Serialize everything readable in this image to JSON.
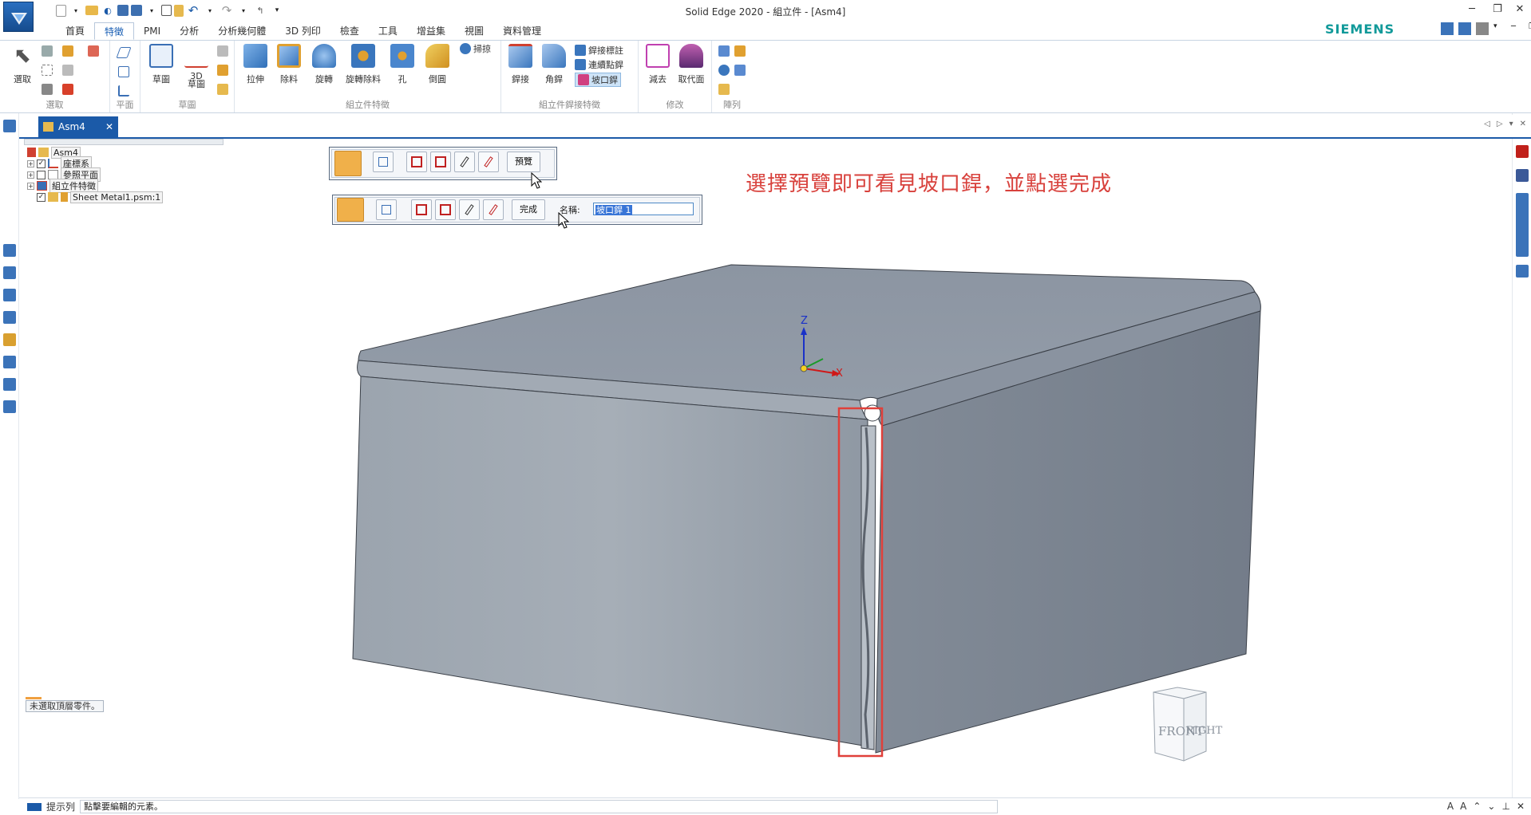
{
  "window": {
    "title": "Solid Edge 2020 - 組立件 - [Asm4]",
    "minimize": "─",
    "restore": "❐",
    "close": "✕"
  },
  "brand": "SIEMENS",
  "ribbon_tabs": [
    "首頁",
    "特徵",
    "PMI",
    "分析",
    "分析幾何體",
    "3D 列印",
    "檢查",
    "工具",
    "增益集",
    "視圖",
    "資料管理"
  ],
  "active_tab": "特徵",
  "ribbon": {
    "select_group": {
      "label": "選取",
      "select_btn": "選取"
    },
    "plane_group": {
      "label": "平面"
    },
    "sketch_group": {
      "label": "草圖",
      "sketch_btn": "草圖",
      "sketch3d_btn": "3D\n草圖"
    },
    "assembly_features": {
      "label": "組立件特徵",
      "buttons": [
        "拉伸",
        "除料",
        "旋轉",
        "旋轉除料",
        "孔",
        "倒圓"
      ],
      "sweep": "掃掠"
    },
    "weld_features": {
      "label": "組立件銲接特徵",
      "buttons": [
        "銲接",
        "角銲"
      ],
      "weld_label_btn": "銲接標註",
      "stitch_weld_btn": "連續點銲",
      "groove_weld_btn": "坡口銲"
    },
    "modify_group": {
      "label": "修改",
      "buttons": [
        "減去",
        "取代面"
      ]
    },
    "pattern_group": {
      "label": "陣列"
    }
  },
  "document_tab": {
    "name": "Asm4"
  },
  "pathfinder": {
    "tree": [
      {
        "label": "Asm4",
        "level": 0
      },
      {
        "label": "座標系",
        "level": 1,
        "checked": true
      },
      {
        "label": "參照平面",
        "level": 1,
        "checked": false
      },
      {
        "label": "組立件特徵",
        "level": 1
      },
      {
        "label": "Sheet Metal1.psm:1",
        "level": 1,
        "checked": true
      }
    ],
    "status": "未選取頂層零件。"
  },
  "commandbar_preview": {
    "preview_btn": "預覽"
  },
  "commandbar_finish": {
    "finish_btn": "完成",
    "name_label": "名稱:",
    "name_value": "坡口銲 1"
  },
  "annotation": "選擇預覽即可看見坡口銲，並點選完成",
  "triad": {
    "z": "Z",
    "x": "X"
  },
  "viewcube": {
    "front": "FRONT",
    "right": "RIGHT"
  },
  "statusbar": {
    "label": "提示列",
    "prompt": "點擊要編輯的元素。"
  },
  "colors": {
    "accent": "#1b5aa8",
    "annotation": "#d8413c",
    "highlight_box": "#e0403a",
    "model_top": "#8e97a3",
    "model_front": "#9aa3ad",
    "model_side": "#7d8693"
  }
}
